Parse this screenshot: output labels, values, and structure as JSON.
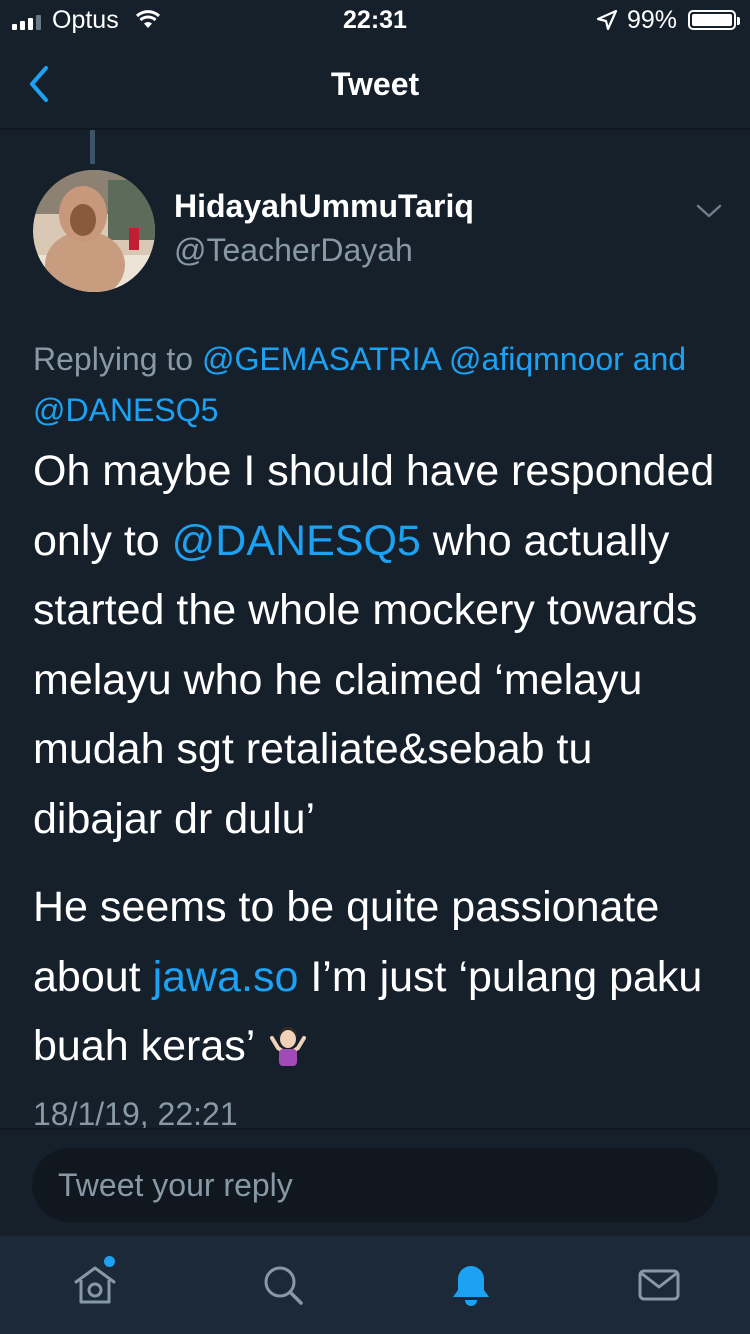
{
  "status_bar": {
    "carrier": "Optus",
    "time": "22:31",
    "battery_percent": "99%",
    "battery_level": 0.99,
    "icons": [
      "signal-icon",
      "wifi-icon",
      "location-arrow-icon",
      "battery-icon"
    ]
  },
  "nav": {
    "title": "Tweet",
    "back_icon": "chevron-left-icon"
  },
  "tweet": {
    "display_name": "HidayahUmmuTariq",
    "handle": "@TeacherDayah",
    "replying_prefix": "Replying to",
    "reply_mention_1": "@GEMASATRIA",
    "reply_mention_2": "@afiqmnoor",
    "reply_and": "and",
    "reply_mention_3": "@DANESQ5",
    "p1_before": "Oh maybe I should have responded only to",
    "p1_mention": "@DANESQ5",
    "p1_after": "who actually started the whole mockery towards melayu who he claimed ‘melayu mudah sgt retaliate&sebab tu dibajar dr dulu’",
    "p2_before": "He seems to be quite passionate about",
    "p2_link": "jawa.so",
    "p2_after": "I’m just ‘pulang paku buah keras’",
    "emoji": "woman-shrugging-emoji",
    "timestamp": "18/1/19, 22:21"
  },
  "reply": {
    "placeholder": "Tweet your reply"
  },
  "tab_bar": {
    "items": [
      "home-icon",
      "search-icon",
      "notifications-icon",
      "messages-icon"
    ],
    "active": "notifications-icon",
    "home_has_new_dot": true
  },
  "colors": {
    "background": "#15202b",
    "tab_bar": "#1c2938",
    "accent": "#1da1f2",
    "muted_text": "#8899a6"
  }
}
